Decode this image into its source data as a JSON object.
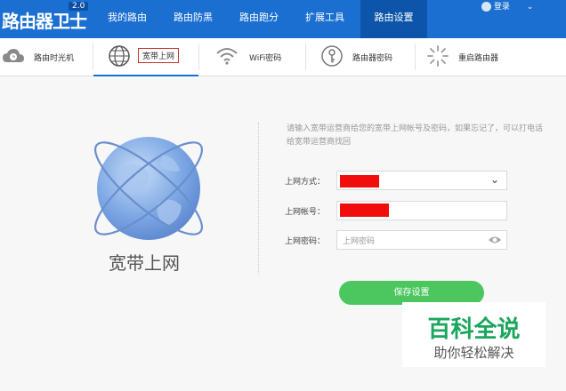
{
  "app": {
    "title": "路由器卫士",
    "version": "2.0"
  },
  "nav": [
    {
      "label": "我的路由"
    },
    {
      "label": "路由防黑"
    },
    {
      "label": "路由跑分"
    },
    {
      "label": "扩展工具"
    },
    {
      "label": "路由设置"
    }
  ],
  "user": {
    "login_label": "登录",
    "menu_icon": "chevron-down-icon"
  },
  "tabs": [
    {
      "label": "路由时光机",
      "icon": "cloud-clock-icon"
    },
    {
      "label": "宽带上网",
      "icon": "globe-icon"
    },
    {
      "label": "WiFi密码",
      "icon": "wifi-icon"
    },
    {
      "label": "路由器密码",
      "icon": "key-icon"
    },
    {
      "label": "重启路由器",
      "icon": "restart-icon"
    }
  ],
  "panel": {
    "caption": "宽带上网",
    "hint": "请输入宽带运营商给您的宽带上网帐号及密码，如果忘记了，可以打电话给宽带运营商找回",
    "fields": {
      "method_label": "上网方式：",
      "account_label": "上网帐号：",
      "password_label": "上网密码：",
      "password_placeholder": "上网密码"
    },
    "save_label": "保存设置"
  },
  "watermark": {
    "line1": "百科全说",
    "line2": "助你轻松解决"
  },
  "colors": {
    "brand": "#1b6fd1",
    "save": "#4cc760",
    "redaction": "#f20d0d"
  }
}
